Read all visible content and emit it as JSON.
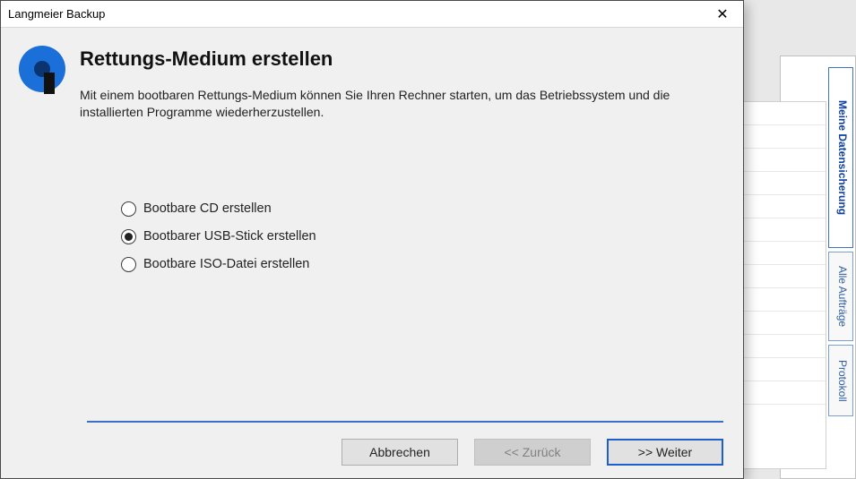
{
  "dialog": {
    "title": "Langmeier Backup",
    "heading": "Rettungs-Medium erstellen",
    "description": "Mit einem bootbaren Rettungs-Medium können Sie Ihren Rechner starten, um das Betriebssystem und die installierten Programme wiederherzustellen.",
    "options": [
      {
        "label": "Bootbare CD erstellen",
        "selected": false
      },
      {
        "label": "Bootbarer USB-Stick erstellen",
        "selected": true
      },
      {
        "label": "Bootbare ISO-Datei erstellen",
        "selected": false
      }
    ],
    "buttons": {
      "cancel": "Abbrechen",
      "back": "<< Zurück",
      "next": ">> Weiter"
    }
  },
  "background": {
    "tabs": [
      {
        "label": "Meine Datensicherung",
        "active": true
      },
      {
        "label": "Alle Aufträge",
        "active": false
      },
      {
        "label": "Protokoll",
        "active": false
      }
    ]
  }
}
